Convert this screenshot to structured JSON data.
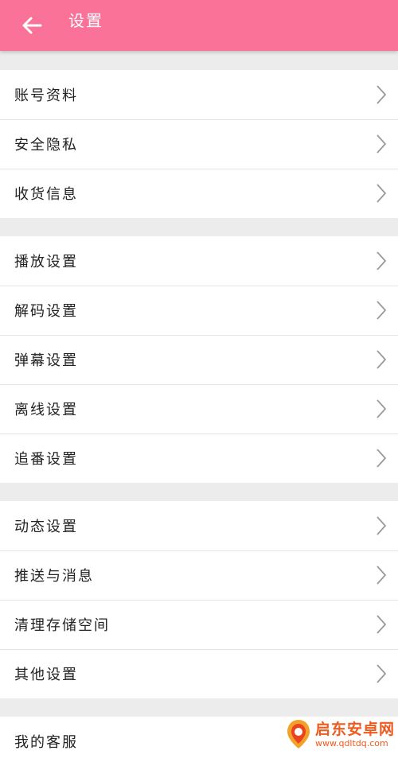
{
  "header": {
    "title": "设置",
    "back_icon": "arrow-left-icon",
    "background_color": "#fa7298"
  },
  "groups": [
    {
      "items": [
        {
          "label": "账号资料"
        },
        {
          "label": "安全隐私"
        },
        {
          "label": "收货信息"
        }
      ]
    },
    {
      "items": [
        {
          "label": "播放设置"
        },
        {
          "label": "解码设置"
        },
        {
          "label": "弹幕设置"
        },
        {
          "label": "离线设置"
        },
        {
          "label": "追番设置"
        }
      ]
    },
    {
      "items": [
        {
          "label": "动态设置"
        },
        {
          "label": "推送与消息"
        },
        {
          "label": "清理存储空间"
        },
        {
          "label": "其他设置"
        }
      ]
    },
    {
      "items": [
        {
          "label": "我的客服"
        }
      ]
    }
  ],
  "row_icon": "chevron-right-icon",
  "watermark": {
    "name": "启东安卓网",
    "url": "www.qdltdq.com",
    "color": "#ef5a1f"
  }
}
